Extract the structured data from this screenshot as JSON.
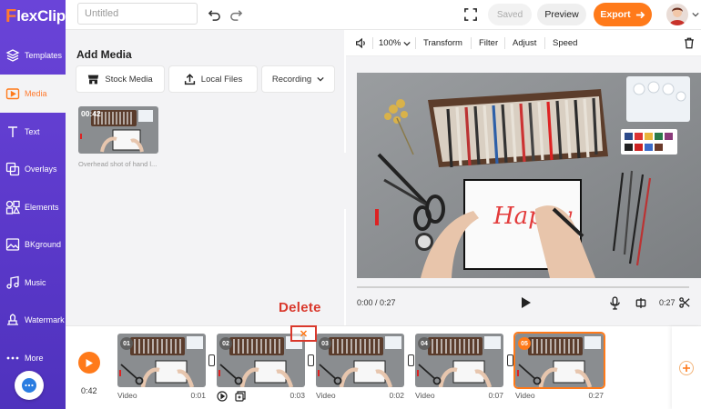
{
  "app": {
    "logo_first": "F",
    "logo_rest": "lexClip"
  },
  "sidebar": {
    "items": [
      {
        "label": "Templates",
        "icon": "templates-icon"
      },
      {
        "label": "Media",
        "icon": "media-icon",
        "active": true
      },
      {
        "label": "Text",
        "icon": "text-icon"
      },
      {
        "label": "Overlays",
        "icon": "overlays-icon"
      },
      {
        "label": "Elements",
        "icon": "elements-icon"
      },
      {
        "label": "BKground",
        "icon": "background-icon"
      },
      {
        "label": "Music",
        "icon": "music-icon"
      },
      {
        "label": "Watermark",
        "icon": "watermark-icon"
      },
      {
        "label": "More",
        "icon": "more-icon"
      }
    ]
  },
  "topbar": {
    "title_placeholder": "Untitled",
    "saved_label": "Saved",
    "preview_label": "Preview",
    "export_label": "Export"
  },
  "media_panel": {
    "title": "Add Media",
    "buttons": {
      "stock": "Stock Media",
      "local": "Local Files",
      "recording": "Recording"
    },
    "item": {
      "duration": "00:42",
      "caption": "Overhead shot of hand l..."
    }
  },
  "editor_toolbar": {
    "zoom": "100%",
    "transform": "Transform",
    "filter": "Filter",
    "adjust": "Adjust",
    "speed": "Speed"
  },
  "player": {
    "current_time": "0:00 / 0:27",
    "end_time": "0:27",
    "video_text": "Happy"
  },
  "timeline": {
    "total_time": "0:42",
    "clips": [
      {
        "num": "01",
        "label": "Video",
        "duration": "0:01"
      },
      {
        "num": "02",
        "label": "Video",
        "duration": "0:03"
      },
      {
        "num": "03",
        "label": "Video",
        "duration": "0:02"
      },
      {
        "num": "04",
        "label": "Video",
        "duration": "0:07"
      },
      {
        "num": "05",
        "label": "Video",
        "duration": "0:27",
        "active": true
      }
    ]
  },
  "annotation": {
    "delete_label": "Delete"
  },
  "colors": {
    "accent": "#ff7a1a",
    "sidebar": "#5a38c9",
    "annotation": "#d9382c"
  }
}
